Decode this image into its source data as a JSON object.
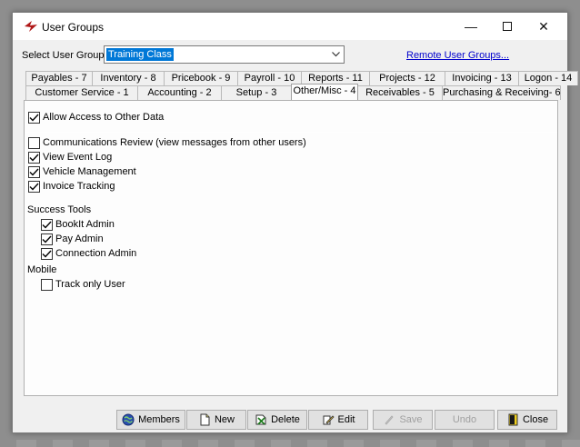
{
  "window": {
    "title": "User Groups",
    "minimize_glyph": "—",
    "close_glyph": "✕"
  },
  "select_group": {
    "label": "Select User Group",
    "value": "Training Class",
    "remote_link": "Remote User Groups..."
  },
  "tabs": {
    "top": [
      "Payables - 7",
      "Inventory - 8",
      "Pricebook - 9",
      "Payroll - 10",
      "Reports - 11",
      "Projects - 12",
      "Invoicing - 13",
      "Logon - 14"
    ],
    "bottom": [
      "Customer Service - 1",
      "Accounting - 2",
      "Setup - 3",
      "Other/Misc - 4",
      "Receivables - 5",
      "Purchasing & Receiving- 6"
    ],
    "active": "Other/Misc - 4"
  },
  "options": {
    "allow_access": {
      "label": "Allow Access to Other Data",
      "checked": true
    },
    "communications_review": {
      "label": "Communications Review (view messages from other users)",
      "checked": false
    },
    "view_event_log": {
      "label": "View Event Log",
      "checked": true
    },
    "vehicle_management": {
      "label": "Vehicle Management",
      "checked": true
    },
    "invoice_tracking": {
      "label": "Invoice Tracking",
      "checked": true
    }
  },
  "success_tools": {
    "heading": "Success Tools",
    "bookit_admin": {
      "label": "BookIt Admin",
      "checked": true
    },
    "pay_admin": {
      "label": "Pay Admin",
      "checked": true
    },
    "connection_admin": {
      "label": "Connection Admin",
      "checked": true
    }
  },
  "mobile": {
    "heading": "Mobile",
    "track_only_user": {
      "label": "Track only User",
      "checked": false
    }
  },
  "toolbar": {
    "members": "Members",
    "new": "New",
    "delete": "Delete",
    "edit": "Edit",
    "save": "Save",
    "undo": "Undo",
    "close": "Close"
  },
  "colors": {
    "selection_blue": "#0078d7",
    "link_blue": "#0000cc",
    "window_bg": "#f0f0f0"
  }
}
